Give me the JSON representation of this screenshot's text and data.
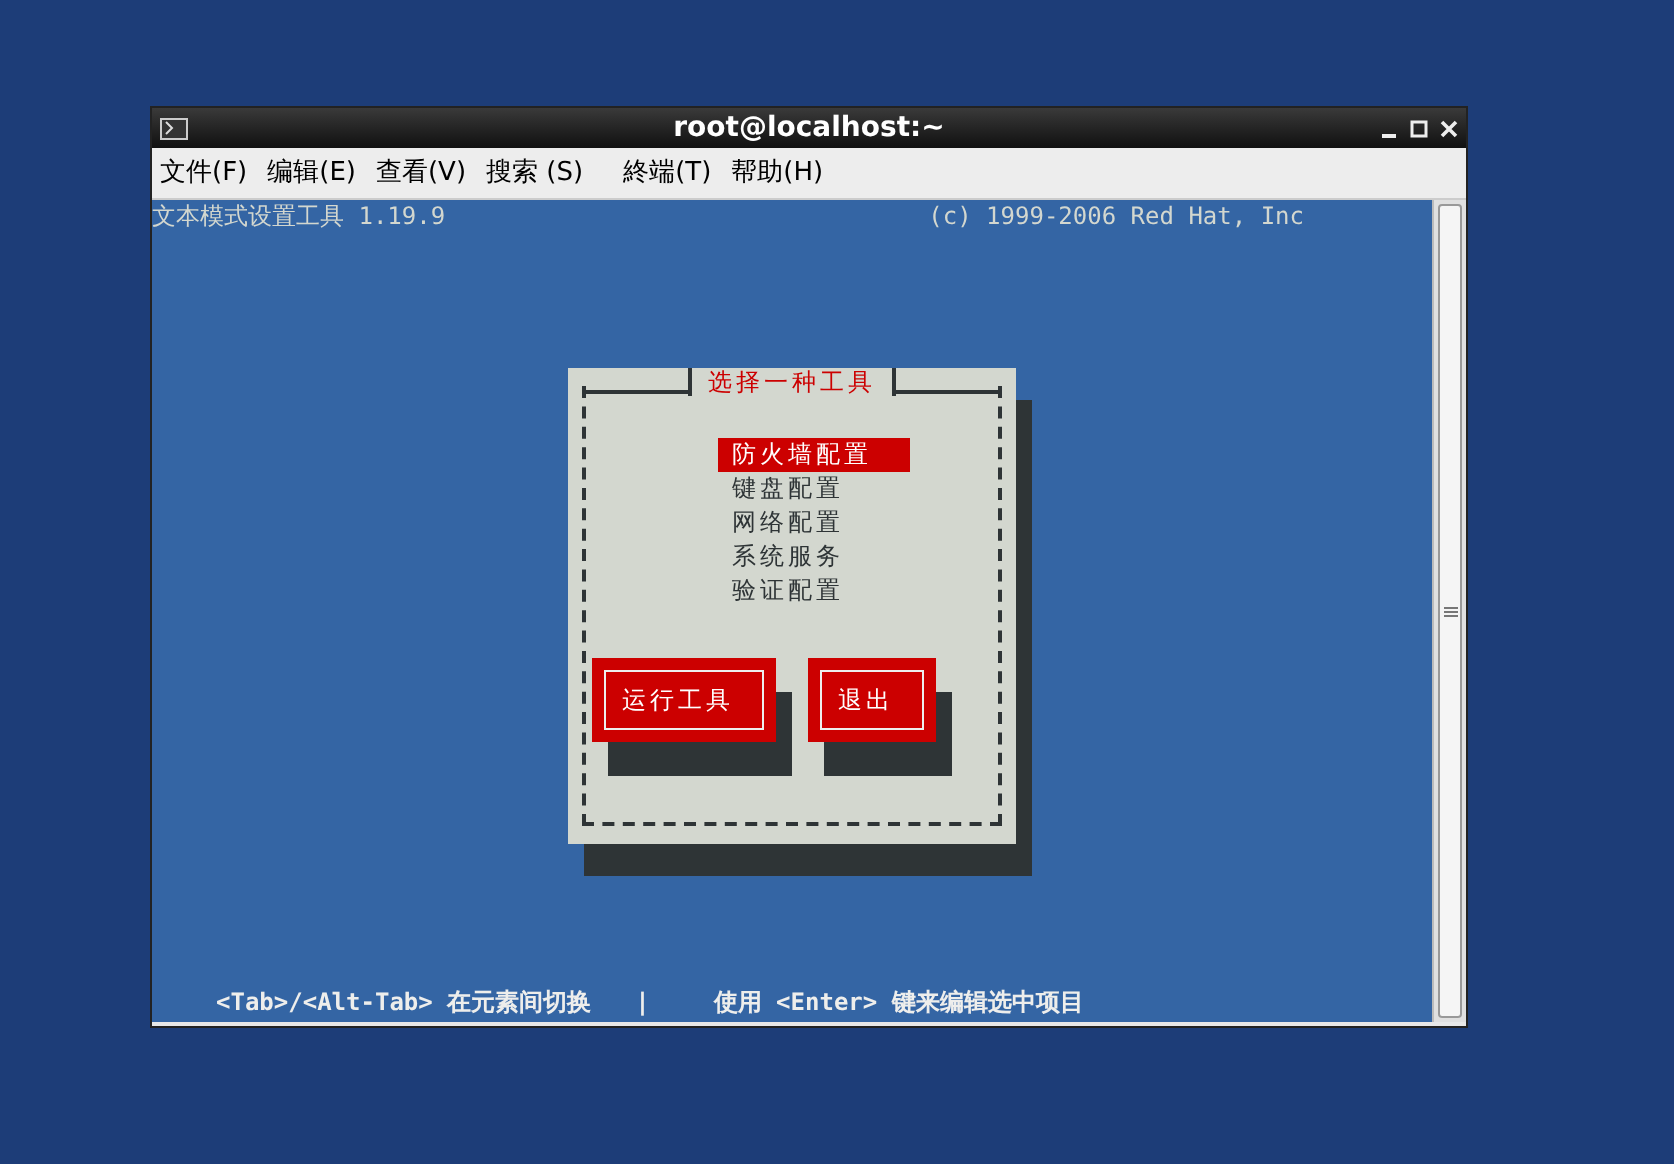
{
  "window": {
    "title": "root@localhost:~"
  },
  "menu": [
    "文件(F)",
    "编辑(E)",
    "查看(V)",
    "搜索 (S)",
    "終端(T)",
    "帮助(H)"
  ],
  "terminal": {
    "header_left": "文本模式设置工具 1.19.9",
    "header_right": "(c) 1999-2006 Red Hat, Inc",
    "dialog": {
      "title": "选择一种工具",
      "tools": [
        {
          "label": "防火墙配置",
          "selected": true
        },
        {
          "label": "键盘配置",
          "selected": false
        },
        {
          "label": "网络配置",
          "selected": false
        },
        {
          "label": "系统服务",
          "selected": false
        },
        {
          "label": "验证配置",
          "selected": false
        }
      ],
      "buttons": [
        "运行工具",
        "退出"
      ]
    },
    "footer_left": "<Tab>/<Alt-Tab> 在元素间切换",
    "footer_separator": "|",
    "footer_right": "使用 <Enter> 键来编辑选中项目"
  }
}
